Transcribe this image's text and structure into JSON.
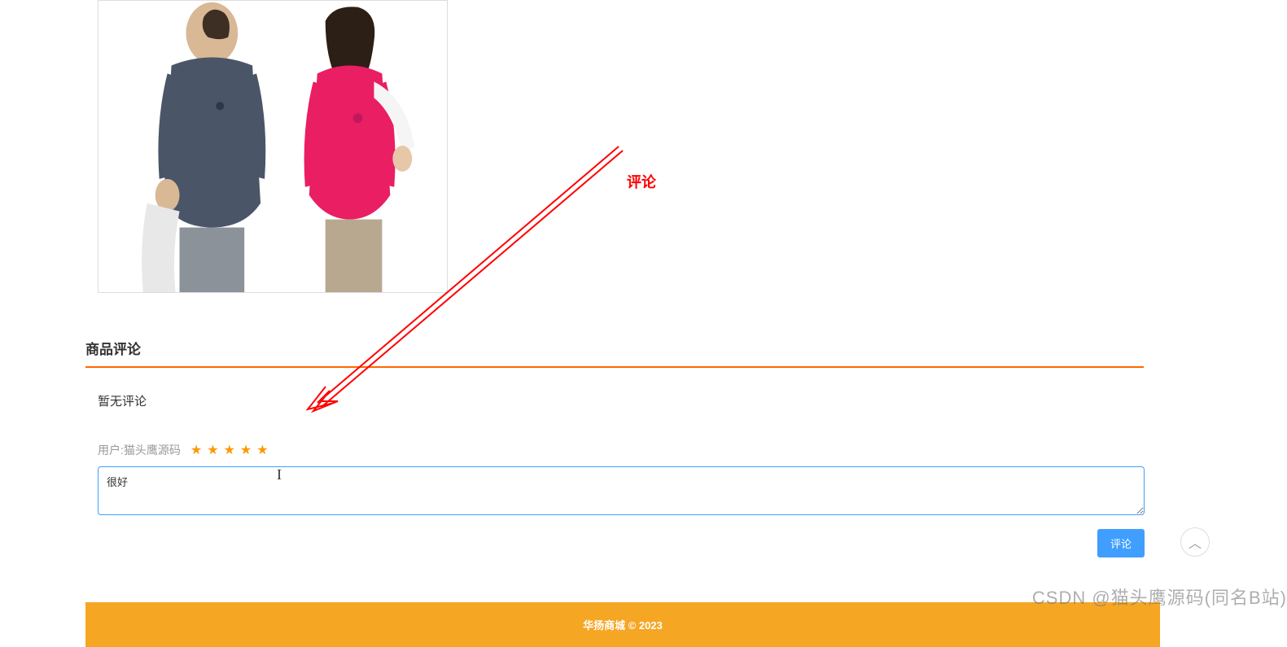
{
  "section": {
    "title": "商品评论",
    "no_comments": "暂无评论"
  },
  "form": {
    "user_label": "用户:猫头鹰源码",
    "textarea_value": "很好",
    "textarea_placeholder": "",
    "submit_label": "评论",
    "star_count": 5
  },
  "footer": {
    "text": "华扬商城 © 2023"
  },
  "annotation": {
    "label": "评论"
  },
  "watermark": {
    "text": "CSDN @猫头鹰源码(同名B站)"
  },
  "icons": {
    "chevron_up": "︿"
  }
}
